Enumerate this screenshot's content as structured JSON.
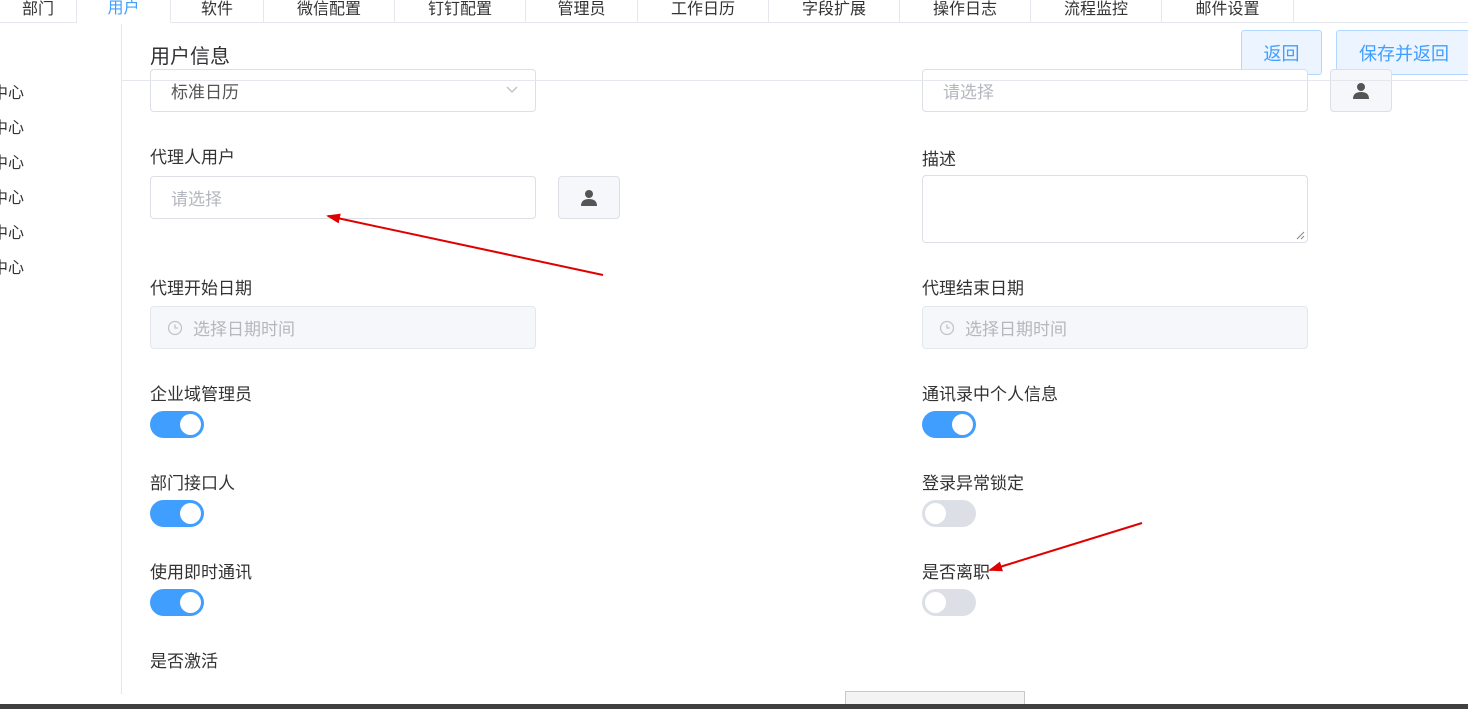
{
  "tabs": [
    {
      "label": "部门",
      "active": false
    },
    {
      "label": "用户",
      "active": true
    },
    {
      "label": "软件",
      "active": false
    },
    {
      "label": "微信配置",
      "active": false
    },
    {
      "label": "钉钉配置",
      "active": false
    },
    {
      "label": "管理员",
      "active": false
    },
    {
      "label": "工作日历",
      "active": false
    },
    {
      "label": "字段扩展",
      "active": false
    },
    {
      "label": "操作日志",
      "active": false
    },
    {
      "label": "流程监控",
      "active": false
    },
    {
      "label": "邮件设置",
      "active": false
    }
  ],
  "sidebar": {
    "items": [
      {
        "label": "中心"
      },
      {
        "label": "中心"
      },
      {
        "label": "中心"
      },
      {
        "label": "中心"
      },
      {
        "label": "中心"
      },
      {
        "label": "中心"
      }
    ]
  },
  "header": {
    "title": "用户信息",
    "back_label": "返回",
    "save_back_label": "保存并返回"
  },
  "form": {
    "calendar_value": "标准日历",
    "right_top_placeholder": "请选择",
    "proxy_user_label": "代理人用户",
    "proxy_user_placeholder": "请选择",
    "description_label": "描述",
    "proxy_start_label": "代理开始日期",
    "proxy_start_placeholder": "选择日期时间",
    "proxy_end_label": "代理结束日期",
    "proxy_end_placeholder": "选择日期时间",
    "switches": {
      "domain_admin": {
        "label": "企业域管理员",
        "on": true
      },
      "contact_personal_info": {
        "label": "通讯录中个人信息",
        "on": true
      },
      "dept_contact": {
        "label": "部门接口人",
        "on": true
      },
      "login_lock": {
        "label": "登录异常锁定",
        "on": false
      },
      "instant_messaging": {
        "label": "使用即时通讯",
        "on": true
      },
      "resigned": {
        "label": "是否离职",
        "on": false
      },
      "activated": {
        "label": "是否激活"
      }
    }
  },
  "colors": {
    "accent": "#409eff",
    "annotation_arrow": "#e00000",
    "switch_off": "#dcdfe6"
  },
  "icons": {
    "user_picker": "user-icon",
    "chevron": "chevron-down-icon",
    "clock": "clock-icon"
  }
}
